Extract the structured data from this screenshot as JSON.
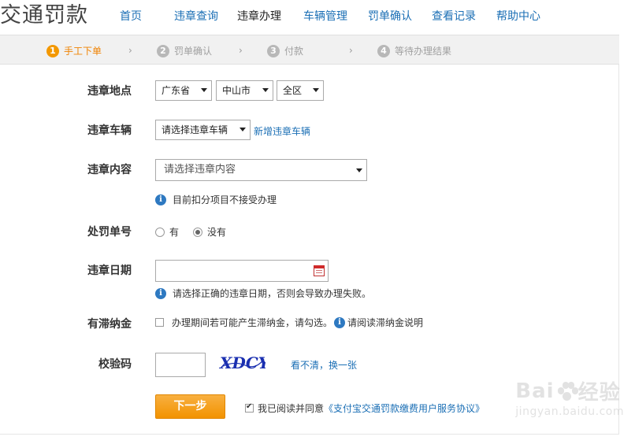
{
  "header": {
    "logo": "交通罚款",
    "nav": [
      "首页",
      "违章查询",
      "违章办理",
      "车辆管理",
      "罚单确认",
      "查看记录",
      "帮助中心"
    ],
    "active_nav": "违章办理"
  },
  "steps": [
    {
      "num": "1",
      "label": "手工下单"
    },
    {
      "num": "2",
      "label": "罚单确认"
    },
    {
      "num": "3",
      "label": "付款"
    },
    {
      "num": "4",
      "label": "等待办理结果"
    }
  ],
  "form": {
    "location": {
      "label": "违章地点",
      "province": "广东省",
      "city": "中山市",
      "district": "全区"
    },
    "vehicle": {
      "label": "违章车辆",
      "select": "请选择违章车辆",
      "add_link": "新增违章车辆"
    },
    "content": {
      "label": "违章内容",
      "select": "请选择违章内容",
      "hint": "目前扣分项目不接受办理"
    },
    "ticket": {
      "label": "处罚单号",
      "option_yes": "有",
      "option_no": "没有",
      "selected": "没有"
    },
    "date": {
      "label": "违章日期",
      "value": "",
      "hint": "请选择正确的违章日期，否则会导致办理失败。"
    },
    "late_fee": {
      "label": "有滞纳金",
      "checkbox_text": "办理期间若可能产生滞纳金，请勾选。",
      "info_link": "请阅读滞纳金说明"
    },
    "captcha": {
      "label": "校验码",
      "value": "",
      "image_text": "XDCY",
      "refresh_link": "看不清，换一张"
    },
    "submit": {
      "label": "下一步",
      "agree_text": "我已阅读并同意",
      "agreement_link": "《支付宝交通罚款缴费用户服务协议》"
    }
  },
  "watermark": {
    "main_left": "Bai",
    "main_right": "经验",
    "sub": "jingyan.baidu.com"
  },
  "colors": {
    "link": "#1b6fb5",
    "accent": "#f39800",
    "info": "#2e79c1"
  }
}
